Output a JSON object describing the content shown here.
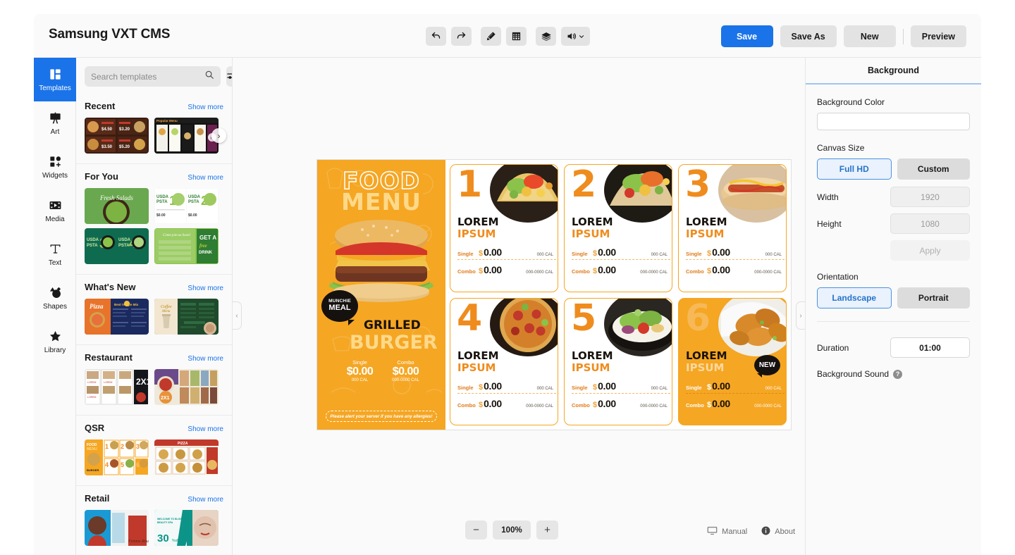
{
  "header": {
    "app_title": "Samsung VXT CMS",
    "tools": [
      {
        "name": "undo-icon",
        "label": "Undo"
      },
      {
        "name": "redo-icon",
        "label": "Redo"
      },
      {
        "name": "ruler-pencil-icon",
        "label": "Design Tools"
      },
      {
        "name": "grid-icon",
        "label": "Grid"
      },
      {
        "name": "layers-icon",
        "label": "Layers"
      },
      {
        "name": "volume-icon",
        "label": "Volume"
      }
    ],
    "actions": {
      "save": "Save",
      "save_as": "Save As",
      "new": "New",
      "preview": "Preview"
    },
    "accent_color": "#1a73e8"
  },
  "rail": {
    "items": [
      {
        "label": "Templates",
        "icon": "templates-icon",
        "active": true
      },
      {
        "label": "Art",
        "icon": "art-icon",
        "active": false
      },
      {
        "label": "Widgets",
        "icon": "widgets-icon",
        "active": false
      },
      {
        "label": "Media",
        "icon": "media-icon",
        "active": false
      },
      {
        "label": "Text",
        "icon": "text-icon",
        "active": false
      },
      {
        "label": "Shapes",
        "icon": "shapes-icon",
        "active": false
      },
      {
        "label": "Library",
        "icon": "library-icon",
        "active": false
      }
    ]
  },
  "templates_panel": {
    "search_placeholder": "Search templates",
    "search_value": "",
    "show_more_label": "Show more",
    "sections": [
      {
        "title": "Recent"
      },
      {
        "title": "For You"
      },
      {
        "title": "What's New"
      },
      {
        "title": "Restaurant"
      },
      {
        "title": "QSR"
      },
      {
        "title": "Retail"
      }
    ]
  },
  "canvas": {
    "collapse_left": "‹",
    "collapse_right": "›",
    "hero": {
      "title_line1": "FOOD",
      "title_line2": "MENU",
      "badge_line1": "MUNCHIE",
      "badge_line2": "MEAL",
      "name_line1": "GRILLED",
      "name_line2": "BURGER",
      "price_single_label": "Single",
      "price_single_value": "$0.00",
      "price_single_cal": "000 CAL",
      "price_combo_label": "Combo",
      "price_combo_value": "$0.00",
      "price_combo_cal": "000-0000 CAL",
      "allergy_note": "Please alert your server if you have any allergies!"
    },
    "items": [
      {
        "number": "1",
        "title_1": "LOREM",
        "title_2": "IPSUM",
        "single_label": "Single",
        "single_price": "$0.00",
        "single_cal": "000 CAL",
        "combo_label": "Combo",
        "combo_price": "$0.00",
        "combo_cal": "000-0000 CAL",
        "badge": "",
        "filled": false,
        "photo": "tacos"
      },
      {
        "number": "2",
        "title_1": "LOREM",
        "title_2": "IPSUM",
        "single_label": "Single",
        "single_price": "$0.00",
        "single_cal": "000 CAL",
        "combo_label": "Combo",
        "combo_price": "$0.00",
        "combo_cal": "000-0000 CAL",
        "badge": "",
        "filled": false,
        "photo": "wrap"
      },
      {
        "number": "3",
        "title_1": "LOREM",
        "title_2": "IPSUM",
        "single_label": "Single",
        "single_price": "$0.00",
        "single_cal": "000 CAL",
        "combo_label": "Combo",
        "combo_price": "$0.00",
        "combo_cal": "000-0000 CAL",
        "badge": "",
        "filled": false,
        "photo": "hotdog"
      },
      {
        "number": "4",
        "title_1": "LOREM",
        "title_2": "IPSUM",
        "single_label": "Single",
        "single_price": "$0.00",
        "single_cal": "000 CAL",
        "combo_label": "Combo",
        "combo_price": "$0.00",
        "combo_cal": "000-0000 CAL",
        "badge": "",
        "filled": false,
        "photo": "pizza"
      },
      {
        "number": "5",
        "title_1": "LOREM",
        "title_2": "IPSUM",
        "single_label": "Single",
        "single_price": "$0.00",
        "single_cal": "000 CAL",
        "combo_label": "Combo",
        "combo_price": "$0.00",
        "combo_cal": "000-0000 CAL",
        "badge": "",
        "filled": false,
        "photo": "salad"
      },
      {
        "number": "6",
        "title_1": "LOREM",
        "title_2": "IPSUM",
        "single_label": "Single",
        "single_price": "$0.00",
        "single_cal": "000 CAL",
        "combo_label": "Combo",
        "combo_price": "$0.00",
        "combo_cal": "000-0000 CAL",
        "badge": "NEW",
        "filled": true,
        "photo": "wings"
      }
    ]
  },
  "zoom_bar": {
    "minus": "−",
    "value": "100%",
    "plus": "+"
  },
  "status_bar": {
    "manual": "Manual",
    "about": "About"
  },
  "right_panel": {
    "title": "Background",
    "background_color_label": "Background Color",
    "background_color_value": "",
    "canvas_size_label": "Canvas Size",
    "canvas_size_options": [
      "Full HD",
      "Custom"
    ],
    "canvas_size_selected": "Full HD",
    "width_label": "Width",
    "width_value": "1920",
    "height_label": "Height",
    "height_value": "1080",
    "apply_label": "Apply",
    "orientation_label": "Orientation",
    "orientation_options": [
      "Landscape",
      "Portrait"
    ],
    "orientation_selected": "Landscape",
    "duration_label": "Duration",
    "duration_value": "01:00",
    "background_sound_label": "Background Sound",
    "help_glyph": "?"
  }
}
